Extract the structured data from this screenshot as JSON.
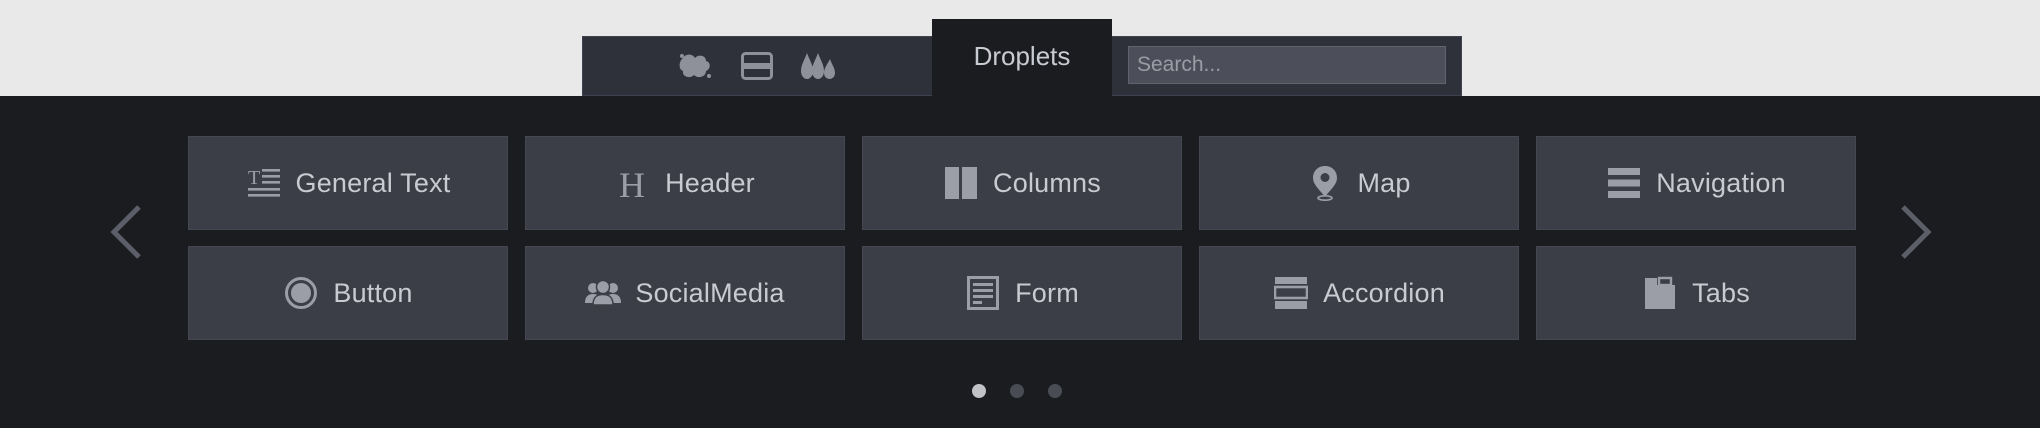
{
  "topbar": {
    "icons": [
      {
        "name": "splash-icon"
      },
      {
        "name": "layout-rows-icon"
      },
      {
        "name": "droplets-icon"
      }
    ],
    "active_tab_label": "Droplets",
    "search_placeholder": "Search..."
  },
  "tiles": [
    {
      "label": "General Text",
      "icon": "text-icon"
    },
    {
      "label": "Header",
      "icon": "header-icon"
    },
    {
      "label": "Columns",
      "icon": "columns-icon"
    },
    {
      "label": "Map",
      "icon": "map-pin-icon"
    },
    {
      "label": "Navigation",
      "icon": "menu-icon"
    },
    {
      "label": "Button",
      "icon": "radio-button-icon"
    },
    {
      "label": "SocialMedia",
      "icon": "users-icon"
    },
    {
      "label": "Form",
      "icon": "form-icon"
    },
    {
      "label": "Accordion",
      "icon": "accordion-icon"
    },
    {
      "label": "Tabs",
      "icon": "tabs-icon"
    }
  ],
  "pagination": {
    "pages": 3,
    "current": 1
  },
  "colors": {
    "panel_bg": "#1b1c20",
    "tile_bg": "#3c3e47",
    "text": "#c8cbd1",
    "icon": "#9b9ea6"
  }
}
